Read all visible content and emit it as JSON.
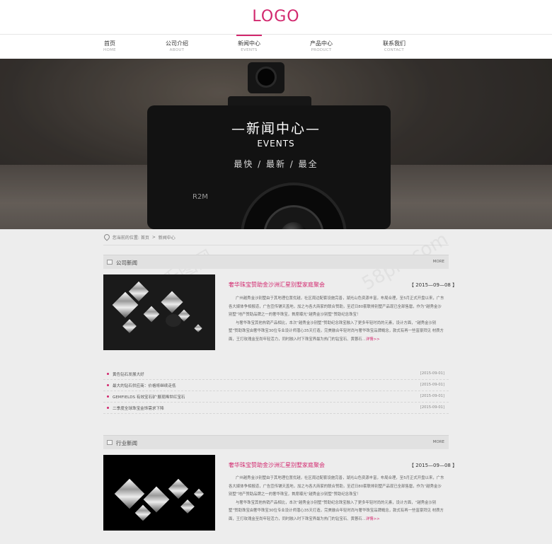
{
  "header": {
    "logo": "LOGO"
  },
  "nav": [
    {
      "cn": "首页",
      "en": "HOME",
      "active": false
    },
    {
      "cn": "公司介绍",
      "en": "ABOUT",
      "active": false
    },
    {
      "cn": "新闻中心",
      "en": "EVENTS",
      "active": true
    },
    {
      "cn": "产品中心",
      "en": "PRODUCT",
      "active": false
    },
    {
      "cn": "联系我们",
      "en": "CONTACT",
      "active": false
    }
  ],
  "banner": {
    "title": "—新闻中心—",
    "subtitle": "EVENTS",
    "tagline": "最快 / 最新 / 最全",
    "camera_model": "R2M"
  },
  "breadcrumb": {
    "prefix": "您当前的位置:",
    "home": "首页",
    "sep": ">",
    "current": "新闻中心"
  },
  "sections": {
    "company": {
      "title": "公司新闻",
      "more": "MORE",
      "feature": {
        "title": "奢华珠宝赞助金沙洲汇星别墅家庭聚会",
        "date": "【 2015—09—08 】",
        "para1": "广州越秀金沙别墅由于其地理位置优越，社区周边配套设施完善，湖光山色资源丰富，布局合理，至5月正式开盘以来，广东各大媒体争相报道，广告宣传铺天盖地，加之与各大商家的联合赞助，至近日80套联排别墅产品现已全部售罄，作为“越秀金沙别墅”地产赞助品牌之一的奢华珠宝，首席曝光“越秀金沙别墅”赞助纪念珠宝！",
        "para2": "与奢华珠宝其他热销产品相比，本次“越秀金沙别墅”赞助纪念珠宝融入了更多年轻时尚的元素，设计方面，“越秀金沙别墅”赞助珠宝由奢华珠宝30位专业设计师潜心35天打造，完美融合年轻时尚与奢华珠宝品牌概念，款式有再一些富豪拜见 材质方面，王打玫瑰金至尚年轻活力，同时融入时下珠宝界最为热门的钻宝石、黄蓉石...",
        "detail": "详情>>"
      },
      "list": [
        {
          "text": "黄色钻石发展大好",
          "date": "[2015-09-01]"
        },
        {
          "text": "最大的钻石供应商：价格将继续走低",
          "date": "[2015-09-01]"
        },
        {
          "text": "GEMFIELDS 有效宝石矿'展现稀世红宝石",
          "date": "[2015-09-01]"
        },
        {
          "text": "二季度全球珠宝金饰需求下降",
          "date": "[2015-09-01]"
        }
      ]
    },
    "industry": {
      "title": "行业新闻",
      "more": "MORE",
      "feature": {
        "title": "奢华珠宝赞助金沙洲汇星别墅家庭聚会",
        "date": "【 2015—09—08 】",
        "para1": "广州越秀金沙别墅由于其地理位置优越，社区周边配套设施完善，湖光山色资源丰富，布局合理，至5月正式开盘以来，广东各大媒体争相报道，广告宣传铺天盖地，加之与各大商家的联合赞助，至近日80套联排别墅产品现已全部售罄，作为“越秀金沙别墅”地产赞助品牌之一的奢华珠宝，首席曝光“越秀金沙别墅”赞助纪念珠宝！",
        "para2": "与奢华珠宝其他热销产品相比，本次“越秀金沙别墅”赞助纪念珠宝融入了更多年轻时尚的元素，设计方面，“越秀金沙别墅”赞助珠宝由奢华珠宝30位专业设计师潜心35天打造，完美融合年轻时尚与奢华珠宝品牌概念，款式有再一些富豪拜见 材质方面，王打玫瑰金至尚年轻活力，同时融入时下珠宝界最为热门的钻宝石、黄蓉石...",
        "detail": "详情>>"
      }
    }
  },
  "watermark": {
    "left": "千图网",
    "right": "58pic.com"
  },
  "colors": {
    "accent": "#d2286e",
    "background": "#ededed"
  }
}
